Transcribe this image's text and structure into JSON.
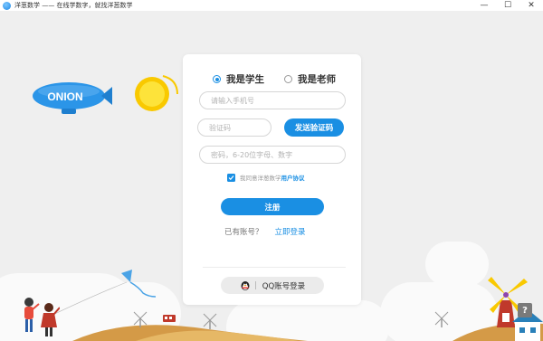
{
  "window": {
    "title": "洋葱数学 —— 在线学数字，就找洋葱数学",
    "minimize": "—",
    "maximize": "☐",
    "close": "✕"
  },
  "scene": {
    "blimp_text": "ONION"
  },
  "form": {
    "roles": [
      {
        "label": "我是学生",
        "selected": true
      },
      {
        "label": "我是老师",
        "selected": false
      }
    ],
    "phone_placeholder": "请输入手机号",
    "phone_value": "",
    "code_placeholder": "验证码",
    "code_value": "",
    "send_code_label": "发送验证码",
    "password_placeholder": "密码，6-20位字母、数字",
    "password_value": "",
    "agree_checked": true,
    "agree_text": "我同意洋葱数学",
    "agreement_link": "用户协议",
    "register_label": "注册",
    "have_account_text": "已有账号？",
    "login_link": "立即登录",
    "qq_login_label": "QQ账号登录"
  },
  "help": {
    "label": "?"
  },
  "colors": {
    "accent": "#1a8fe3",
    "background": "#efefef",
    "card": "#ffffff"
  },
  "icons": [
    "app-logo-icon",
    "minimize-icon",
    "maximize-icon",
    "close-icon",
    "qq-penguin-icon",
    "checkmark-icon",
    "help-icon"
  ]
}
